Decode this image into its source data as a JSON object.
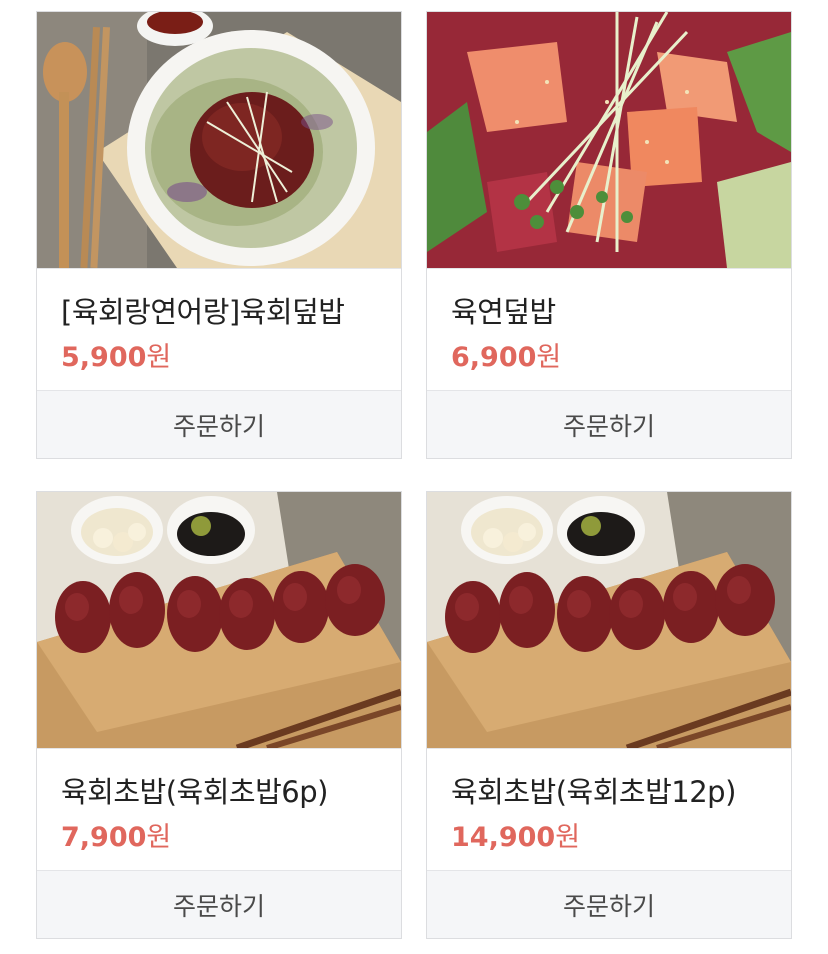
{
  "products": [
    {
      "name": "[육회랑연어랑]육회덮밥",
      "price": "5,900",
      "currency": "원",
      "order_label": "주문하기",
      "image": "yukhoe-rice-bowl-photo"
    },
    {
      "name": "육연덮밥",
      "price": "6,900",
      "currency": "원",
      "order_label": "주문하기",
      "image": "yukhoe-salmon-bowl-photo"
    },
    {
      "name": "육회초밥(육회초밥6p)",
      "price": "7,900",
      "currency": "원",
      "order_label": "주문하기",
      "image": "yukhoe-sushi-photo"
    },
    {
      "name": "육회초밥(육회초밥12p)",
      "price": "14,900",
      "currency": "원",
      "order_label": "주문하기",
      "image": "yukhoe-sushi-photo"
    }
  ],
  "colors": {
    "price": "#e0675d",
    "name": "#222222",
    "order_bg": "#f5f6f8",
    "border": "#dcdde0"
  }
}
